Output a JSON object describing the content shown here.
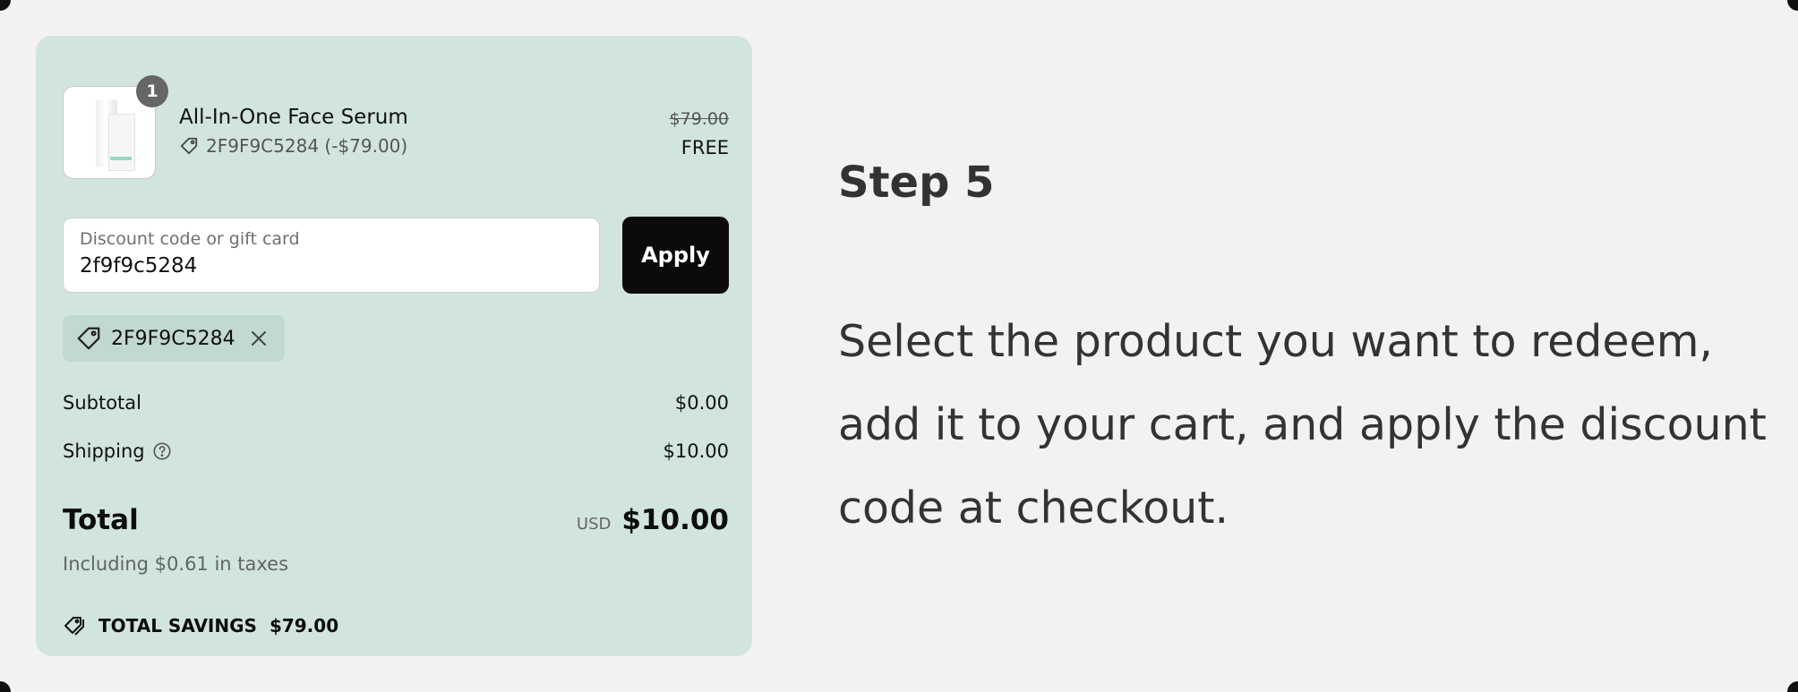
{
  "cart": {
    "item": {
      "quantity": "1",
      "name": "All-In-One Face Serum",
      "discount_line": "2F9F9C5284 (-$79.00)",
      "original_price": "$79.00",
      "price": "FREE"
    },
    "discount": {
      "placeholder": "Discount code or gift card",
      "value": "2f9f9c5284",
      "apply_label": "Apply"
    },
    "applied_code": "2F9F9C5284",
    "summary": {
      "subtotal_label": "Subtotal",
      "subtotal_value": "$0.00",
      "shipping_label": "Shipping",
      "shipping_value": "$10.00",
      "total_label": "Total",
      "currency": "USD",
      "total_value": "$10.00",
      "taxes_note": "Including $0.61 in taxes"
    },
    "savings": {
      "label": "TOTAL SAVINGS",
      "value": "$79.00"
    }
  },
  "instructions": {
    "title": "Step 5",
    "body": "Select the product you want to redeem, add it to your cart, and apply the discount code at checkout."
  },
  "icons": {
    "tag": "tag-icon",
    "close": "close-icon",
    "help": "question-circle-icon",
    "savings": "double-tag-icon"
  },
  "colors": {
    "page_bg": "#f2f2f2",
    "panel_bg": "#d1e4df",
    "button_bg": "#0c0a0a",
    "chip_bg": "#c2d8d2"
  }
}
